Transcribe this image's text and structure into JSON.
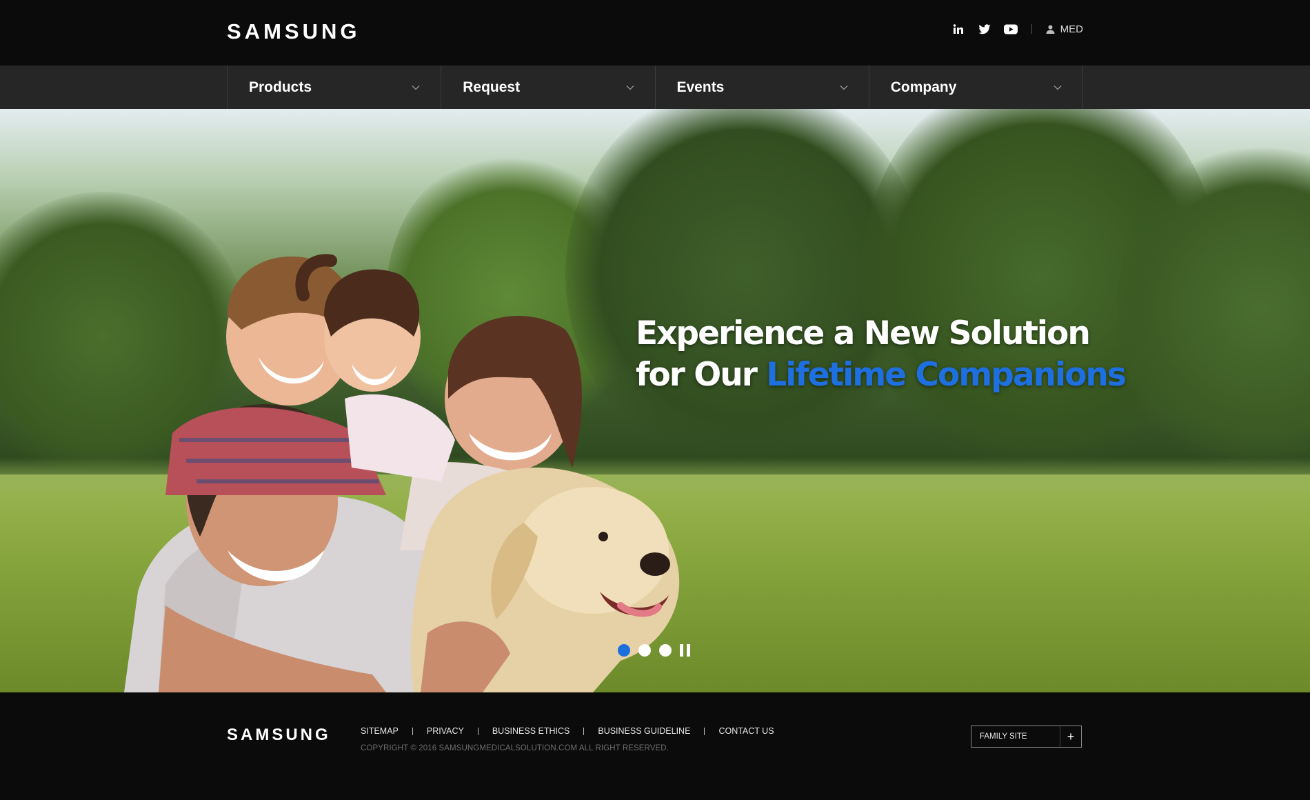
{
  "header": {
    "logo": "SAMSUNG",
    "social": [
      "linkedin-icon",
      "twitter-icon",
      "youtube-icon"
    ],
    "user_label": "MED"
  },
  "nav": {
    "items": [
      {
        "label": "Products"
      },
      {
        "label": "Request"
      },
      {
        "label": "Events"
      },
      {
        "label": "Company"
      }
    ]
  },
  "hero": {
    "line1": "Experience a New Solution",
    "line2_prefix": "for Our ",
    "line2_accent": "Lifetime Companions",
    "slides_total": 3,
    "active_slide": 1,
    "accent_color": "#1e6fe0"
  },
  "footer": {
    "logo": "SAMSUNG",
    "links": [
      "SITEMAP",
      "PRIVACY",
      "BUSINESS ETHICS",
      "BUSINESS GUIDELINE",
      "CONTACT US"
    ],
    "copyright": "COPYRIGHT © 2016 SAMSUNGMEDICALSOLUTION.COM ALL RIGHT RESERVED.",
    "family_site": "FAMILY SITE",
    "family_site_toggle": "+"
  }
}
